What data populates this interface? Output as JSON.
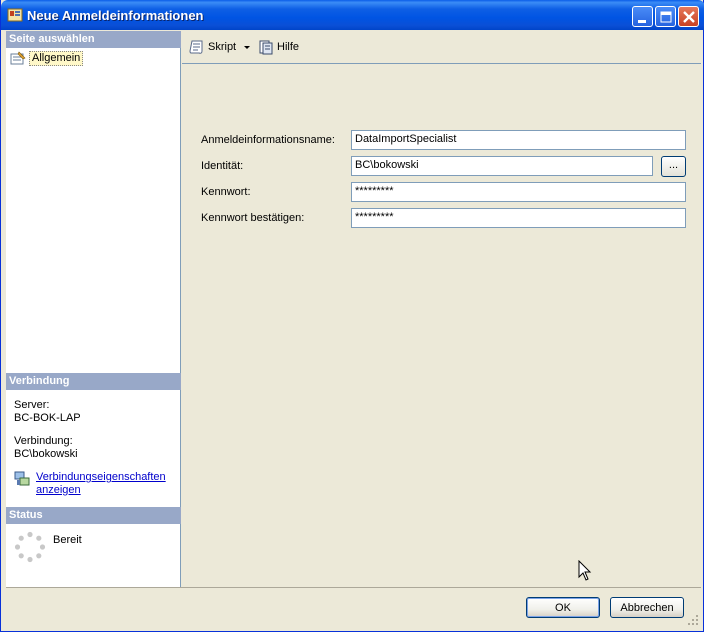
{
  "window": {
    "title": "Neue Anmeldeinformationen"
  },
  "left": {
    "select_page_header": "Seite auswählen",
    "pages": [
      {
        "label": "Allgemein"
      }
    ],
    "connection_header": "Verbindung",
    "server_label": "Server:",
    "server_value": "BC-BOK-LAP",
    "connection_label": "Verbindung:",
    "connection_value": "BC\\bokowski",
    "view_properties_link": "Verbindungseigenschaften anzeigen",
    "status_header": "Status",
    "status_value": "Bereit"
  },
  "toolbar": {
    "script_label": "Skript",
    "help_label": "Hilfe"
  },
  "form": {
    "credential_name_label": "Anmeldeinformationsname:",
    "credential_name_value": "DataImportSpecialist",
    "identity_label": "Identität:",
    "identity_value": "BC\\bokowski",
    "browse_label": "...",
    "password_label": "Kennwort:",
    "password_value": "*********",
    "confirm_password_label": "Kennwort bestätigen:",
    "confirm_password_value": "*********"
  },
  "buttons": {
    "ok_label": "OK",
    "cancel_label": "Abbrechen"
  },
  "colors": {
    "title_bar": "#0054e3",
    "section_header": "#98a8c8",
    "link": "#0000cc"
  }
}
